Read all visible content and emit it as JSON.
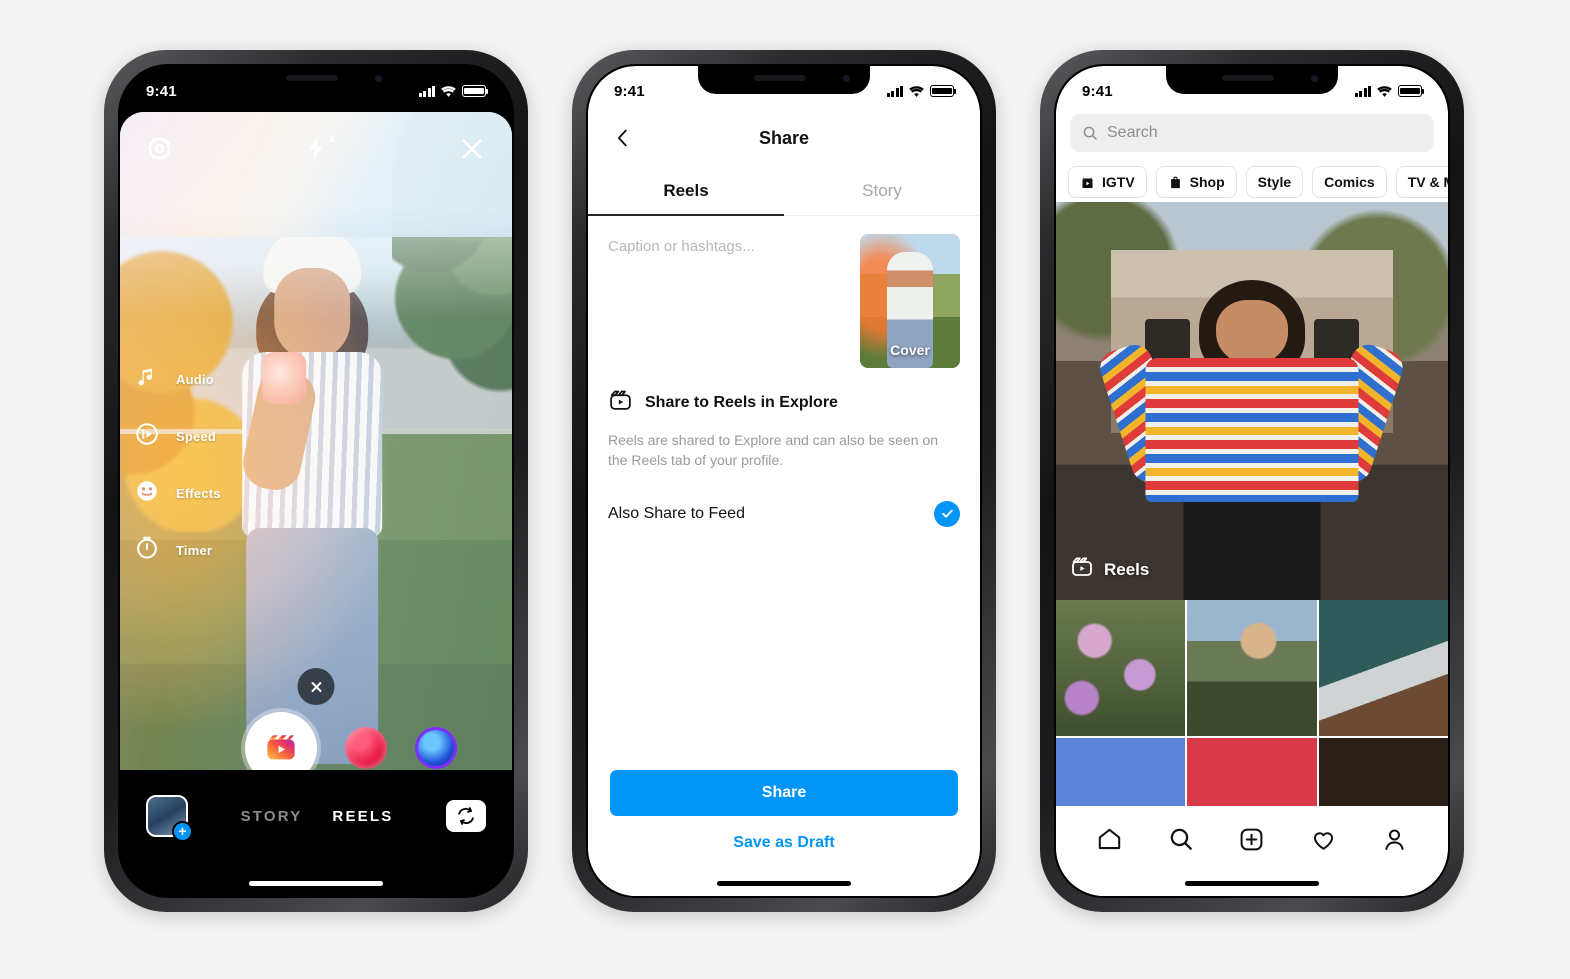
{
  "background_color": "#f3f3f3",
  "accent_color": "#0095f6",
  "phones": {
    "camera": {
      "status": {
        "time": "9:41",
        "signal_icon": "cellular-bars-icon",
        "wifi_icon": "wifi-icon",
        "battery_icon": "battery-icon"
      },
      "top_controls": [
        {
          "name": "settings-gear-icon",
          "label": "Settings"
        },
        {
          "name": "flash-off-icon",
          "label": "Flash off"
        },
        {
          "name": "close-icon",
          "label": "Close"
        }
      ],
      "tools": [
        {
          "icon": "audio-note-icon",
          "label": "Audio"
        },
        {
          "icon": "speed-icon",
          "label": "Speed"
        },
        {
          "icon": "effects-face-icon",
          "label": "Effects"
        },
        {
          "icon": "timer-icon",
          "label": "Timer"
        }
      ],
      "clear_button": "close-icon",
      "shutter": {
        "name": "reels-record-button",
        "icon": "reels-clapper-icon"
      },
      "effect_bubbles": [
        {
          "name": "effect-bubble-hearts",
          "color": "#e8123f"
        },
        {
          "name": "effect-bubble-orb",
          "color": "#2d1b9c"
        }
      ],
      "bottom": {
        "gallery": {
          "name": "gallery-thumbnail",
          "badge": "+"
        },
        "modes": [
          {
            "label": "STORY",
            "active": false
          },
          {
            "label": "REELS",
            "active": true
          }
        ],
        "flip": {
          "name": "flip-camera-icon",
          "label": "Flip camera"
        }
      }
    },
    "share": {
      "status": {
        "time": "9:41"
      },
      "nav": {
        "back_icon": "chevron-left-icon",
        "title": "Share"
      },
      "tabs": [
        {
          "label": "Reels",
          "active": true
        },
        {
          "label": "Story",
          "active": false
        }
      ],
      "caption": {
        "placeholder": "Caption or hashtags...",
        "value": ""
      },
      "cover": {
        "label": "Cover"
      },
      "explore": {
        "icon": "reels-clapper-icon",
        "title": "Share to Reels in Explore",
        "description": "Reels are shared to Explore and can also be seen on the Reels tab of your profile.",
        "toggle_row": {
          "label": "Also Share to Feed",
          "checked": true,
          "icon": "check-circle-icon"
        }
      },
      "primary_button": "Share",
      "secondary_button": "Save as Draft"
    },
    "explore": {
      "status": {
        "time": "9:41"
      },
      "search": {
        "placeholder": "Search",
        "value": "",
        "icon": "search-icon"
      },
      "chips": [
        {
          "label": "IGTV",
          "icon": "igtv-icon"
        },
        {
          "label": "Shop",
          "icon": "shopping-bag-icon"
        },
        {
          "label": "Style",
          "icon": null
        },
        {
          "label": "Comics",
          "icon": null
        },
        {
          "label": "TV & Movies",
          "icon": null
        }
      ],
      "hero": {
        "badge_label": "Reels",
        "badge_icon": "reels-clapper-icon"
      },
      "grid_cells": [
        {
          "name": "grid-cell-flowers"
        },
        {
          "name": "grid-cell-family-tree"
        },
        {
          "name": "grid-cell-skateboard"
        },
        {
          "name": "grid-cell-hands-sky"
        },
        {
          "name": "grid-cell-red-jacket"
        },
        {
          "name": "grid-cell-portrait"
        }
      ],
      "tabbar": [
        {
          "name": "tab-home",
          "icon": "home-icon"
        },
        {
          "name": "tab-search",
          "icon": "search-icon"
        },
        {
          "name": "tab-create",
          "icon": "plus-square-icon"
        },
        {
          "name": "tab-activity",
          "icon": "heart-icon"
        },
        {
          "name": "tab-profile",
          "icon": "person-icon"
        }
      ]
    }
  }
}
